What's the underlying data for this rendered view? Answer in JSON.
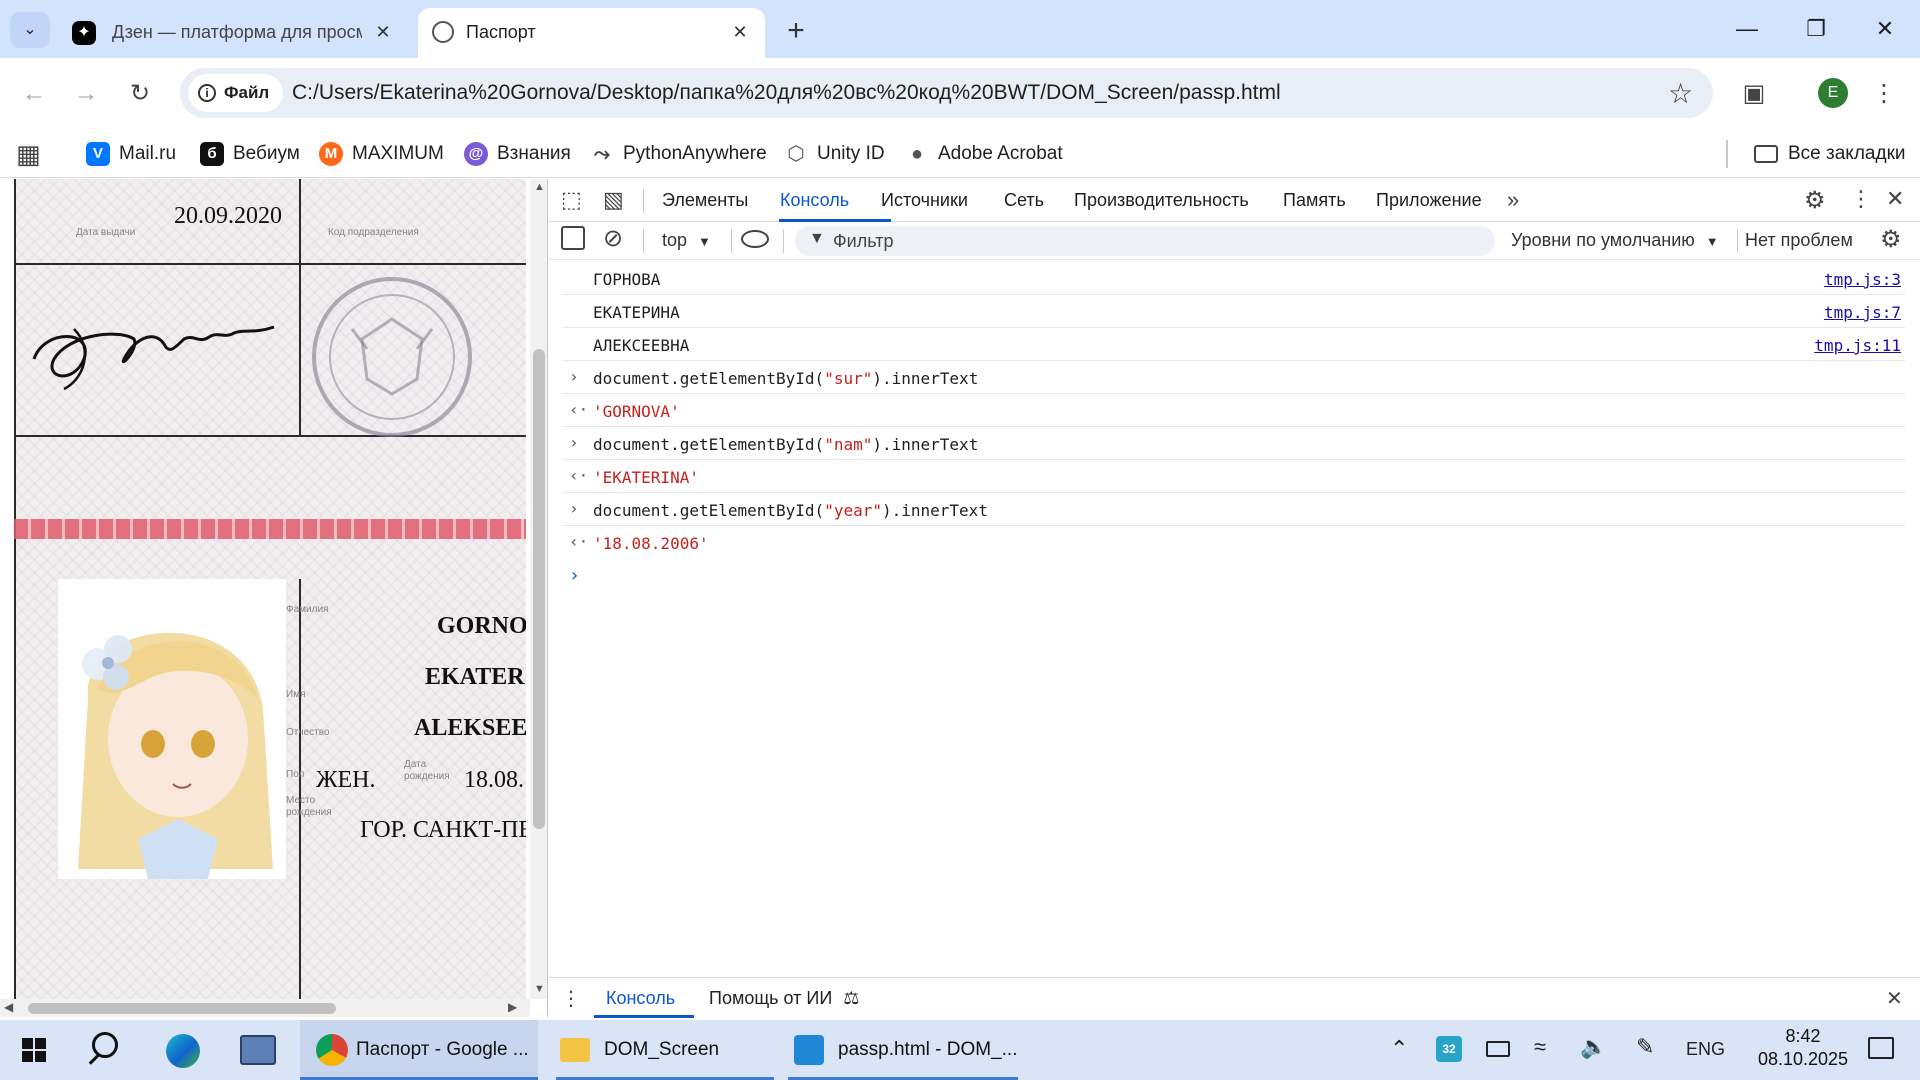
{
  "browser": {
    "tabs": [
      {
        "title": "Дзен — платформа для просм",
        "active": false
      },
      {
        "title": "Паспорт",
        "active": true
      }
    ],
    "new_tab_glyph": "+",
    "address": {
      "chip_label": "Файл",
      "url": "C:/Users/Ekaterina%20Gornova/Desktop/папка%20для%20вс%20код%20BWT/DOM_Screen/passp.html"
    },
    "profile_initial": "E",
    "bookmarks": [
      "Mail.ru",
      "Вебиум",
      "MAXIMUM",
      "Взнания",
      "PythonAnywhere",
      "Unity ID",
      "Adobe Acrobat"
    ],
    "all_bookmarks": "Все закладки"
  },
  "passport": {
    "issue_date": "20.09.2020",
    "label_issue_date": "Дата выдачи",
    "label_division_code": "Код подразделения",
    "label_surname": "Фамилия",
    "label_name": "Имя",
    "label_patronymic": "Отчество",
    "label_sex": "Пол",
    "label_birth_date": "Дата рождения",
    "label_birth_place": "Место рождения",
    "surname": "GORNO",
    "name": "EKATER",
    "patronymic": "ALEKSEE",
    "sex": "ЖЕН.",
    "birth_date": "18.08.",
    "birth_place": "ГОР. САНКТ-ПЕ"
  },
  "devtools": {
    "tabs": [
      "Элементы",
      "Консоль",
      "Источники",
      "Сеть",
      "Производительность",
      "Память",
      "Приложение"
    ],
    "active_tab": "Консоль",
    "context": "top",
    "filter_placeholder": "Фильтр",
    "levels": "Уровни по умолчанию",
    "issues": "Нет проблем",
    "console": [
      {
        "kind": "log",
        "text": "ГОРНОВА",
        "source": "tmp.js:3"
      },
      {
        "kind": "log",
        "text": "ЕКАТЕРИНА",
        "source": "tmp.js:7"
      },
      {
        "kind": "log",
        "text": "АЛЕКСЕЕВНА",
        "source": "tmp.js:11"
      },
      {
        "kind": "input",
        "pre": "document.getElementById(",
        "arg": "\"sur\"",
        "post": ").innerText"
      },
      {
        "kind": "result",
        "text": "'GORNOVA'"
      },
      {
        "kind": "input",
        "pre": "document.getElementById(",
        "arg": "\"nam\"",
        "post": ").innerText"
      },
      {
        "kind": "result",
        "text": "'EKATERINA'"
      },
      {
        "kind": "input",
        "pre": "document.getElementById(",
        "arg": "\"year\"",
        "post": ").innerText"
      },
      {
        "kind": "result",
        "text": "'18.08.2006'"
      }
    ],
    "drawer_tabs": [
      "Консоль",
      "Помощь от ИИ"
    ]
  },
  "taskbar": {
    "apps": [
      "Паспорт - Google ...",
      "DOM_Screen",
      "passp.html - DOM_..."
    ],
    "tray_badge": "32",
    "lang": "ENG",
    "time": "8:42",
    "date": "08.10.2025"
  },
  "colors": {
    "accent": "#0b57d0",
    "tabstrip": "#d3e3fd",
    "taskbar": "#d9e4f6",
    "string": "#c5221f"
  }
}
